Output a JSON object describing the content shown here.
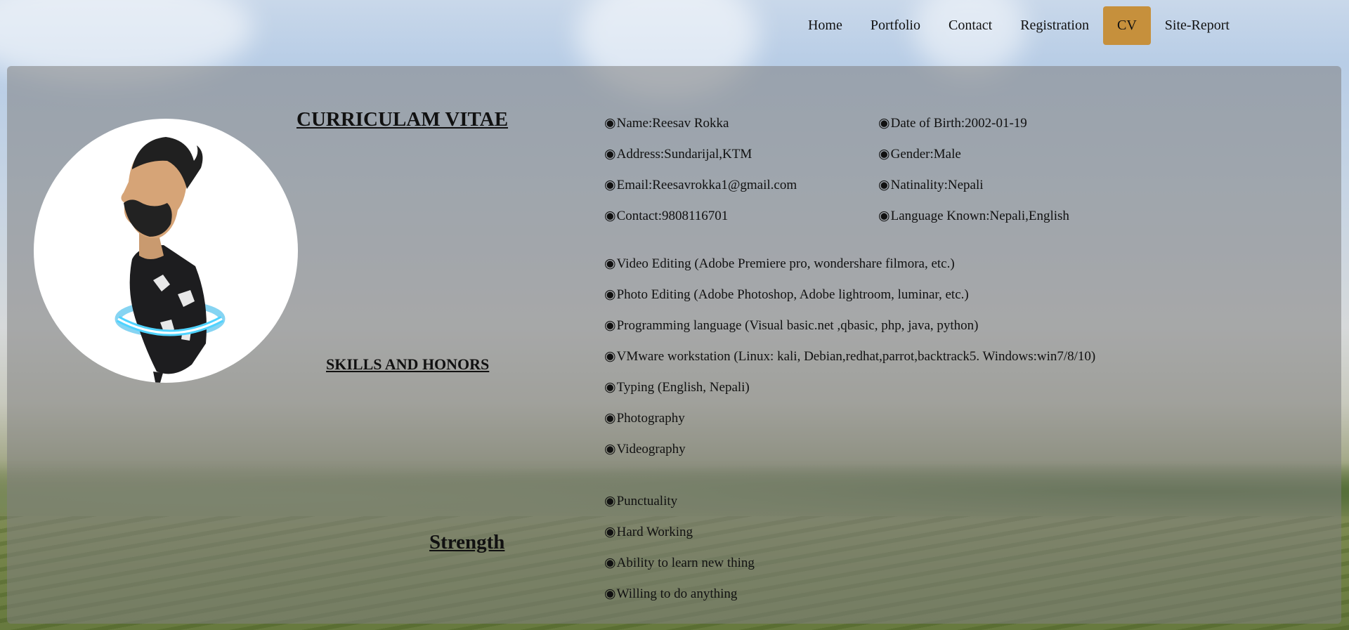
{
  "nav": {
    "items": [
      {
        "label": "Home"
      },
      {
        "label": "Portfolio"
      },
      {
        "label": "Contact"
      },
      {
        "label": "Registration"
      },
      {
        "label": "CV",
        "active": true
      },
      {
        "label": "Site-Report"
      }
    ],
    "active_color": "#c6903c"
  },
  "cv": {
    "title": "CURRICULAM VITAE",
    "bullet": "◉",
    "personal_left": [
      "Name:Reesav Rokka",
      "Address:Sundarijal,KTM",
      "Email:Reesavrokka1@gmail.com",
      "Contact:9808116701"
    ],
    "personal_right": [
      "Date of Birth:2002-01-19",
      "Gender:Male",
      "Natinality:Nepali",
      "Language Known:Nepali,English"
    ],
    "skills_heading": "SKILLS AND HONORS",
    "skills": [
      "Video Editing (Adobe Premiere pro, wondershare filmora, etc.)",
      "Photo Editing (Adobe Photoshop, Adobe lightroom, luminar, etc.)",
      "Programming language (Visual basic.net ,qbasic, php, java, python)",
      "VMware workstation (Linux: kali, Debian,redhat,parrot,backtrack5. Windows:win7/8/10)",
      "Typing (English, Nepali)",
      "Photography",
      "Videography"
    ],
    "strength_heading": "Strength",
    "strengths": [
      "Punctuality",
      "Hard Working",
      "Ability to learn new thing",
      "Willing to do anything"
    ]
  }
}
